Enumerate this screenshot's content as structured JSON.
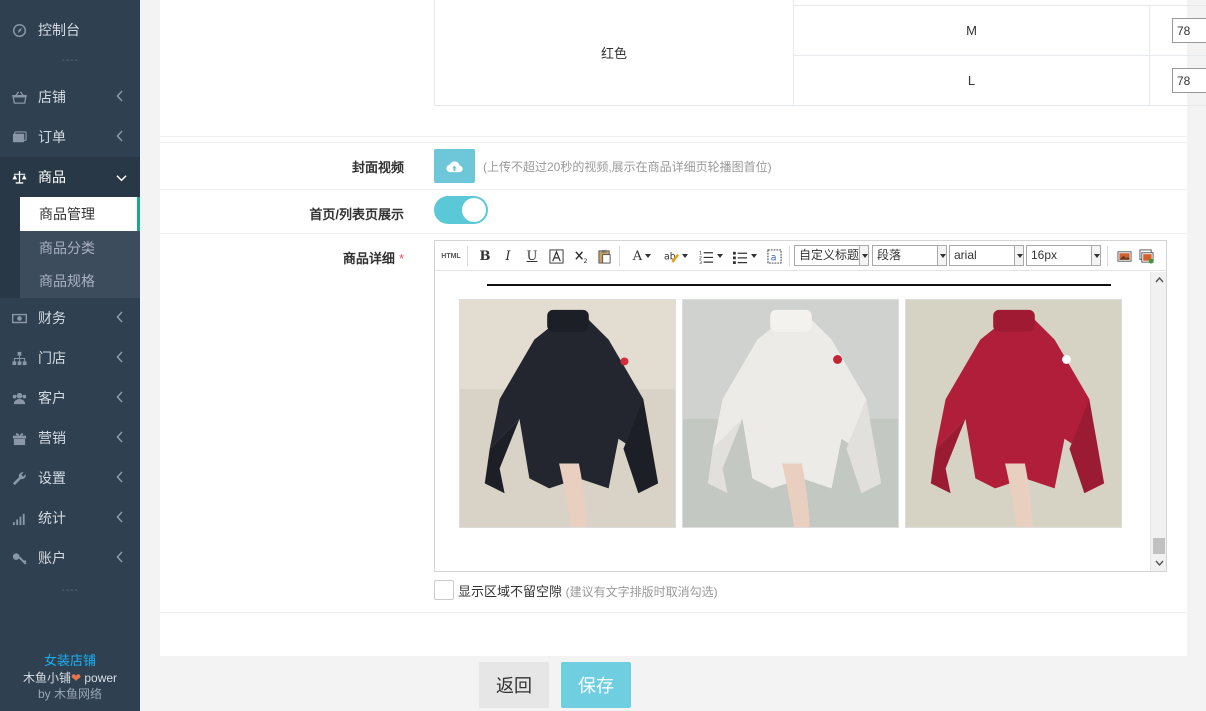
{
  "sidebar": {
    "items": [
      {
        "label": "控制台",
        "icon": "dashboard-icon"
      },
      {
        "label": "店铺",
        "icon": "store-icon"
      },
      {
        "label": "订单",
        "icon": "order-icon"
      },
      {
        "label": "商品",
        "icon": "scale-icon"
      },
      {
        "label": "财务",
        "icon": "money-icon"
      },
      {
        "label": "门店",
        "icon": "sitemap-icon"
      },
      {
        "label": "客户",
        "icon": "users-icon"
      },
      {
        "label": "营销",
        "icon": "gift-icon"
      },
      {
        "label": "设置",
        "icon": "wrench-icon"
      },
      {
        "label": "统计",
        "icon": "signal-icon"
      },
      {
        "label": "账户",
        "icon": "key-icon"
      }
    ],
    "sub_items": [
      "商品管理",
      "商品分类",
      "商品规格"
    ],
    "dots": "----",
    "brand": {
      "store": "女装店铺",
      "app": "木鱼小铺",
      "power": "power",
      "by": "by 木鱼网络"
    }
  },
  "sku": {
    "color": "红色",
    "rows": [
      {
        "size": "M",
        "value": "78"
      },
      {
        "size": "L",
        "value": "78"
      }
    ]
  },
  "form": {
    "cover_video_label": "封面视频",
    "cover_video_hint": "(上传不超过20秒的视频,展示在商品详细页轮播图首位)",
    "home_display_label": "首页/列表页展示",
    "home_display_on": true,
    "detail_label": "商品详细",
    "required_mark": "*",
    "no_gap_label": "显示区域不留空隙",
    "no_gap_hint": "(建议有文字排版时取消勾选)"
  },
  "editor": {
    "html_btn": "HTML",
    "bold": "B",
    "italic": "I",
    "underline": "U",
    "font_color": "A",
    "heading": "自定义标题",
    "paragraph": "段落",
    "font": "arial",
    "size": "16px",
    "images": [
      {
        "desc": "black turtleneck sweater",
        "color": "#23262e"
      },
      {
        "desc": "white turtleneck sweater",
        "color": "#ecebe7"
      },
      {
        "desc": "red turtleneck sweater",
        "color": "#b01e3a"
      }
    ]
  },
  "footer": {
    "back": "返回",
    "save": "保存"
  }
}
